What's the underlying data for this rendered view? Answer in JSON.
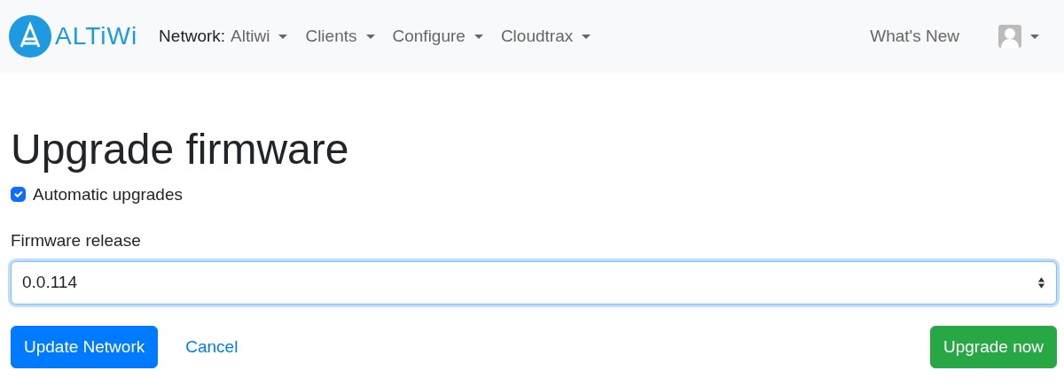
{
  "navbar": {
    "logo_text": "ALTiWi",
    "network_label": "Network:",
    "menus": [
      {
        "label": "Altiwi"
      },
      {
        "label": "Clients"
      },
      {
        "label": "Configure"
      },
      {
        "label": "Cloudtrax"
      }
    ],
    "whats_new": "What's New"
  },
  "title": "Upgrade firmware",
  "automatic_upgrades": {
    "label": "Automatic upgrades",
    "checked": true
  },
  "firmware_release": {
    "label": "Firmware release",
    "value": "0.0.114"
  },
  "buttons": [
    {
      "label": "Update Network",
      "kind": "primary"
    },
    {
      "label": "Cancel",
      "kind": "link"
    },
    {
      "label": "Upgrade now",
      "kind": "success"
    }
  ]
}
